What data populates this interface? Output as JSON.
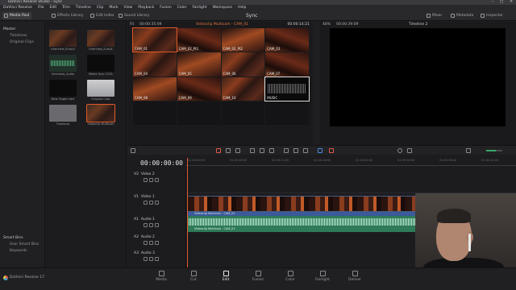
{
  "window": {
    "title": "DaVinci Resolve Studio - Sync"
  },
  "menubar": [
    "DaVinci Resolve",
    "File",
    "Edit",
    "Trim",
    "Timeline",
    "Clip",
    "Mark",
    "View",
    "Playback",
    "Fusion",
    "Color",
    "Fairlight",
    "Workspace",
    "Help"
  ],
  "toolbar": {
    "left": [
      "Media Pool",
      "Effects Library",
      "Edit Index",
      "Sound Library"
    ],
    "app_title": "Sync",
    "right": [
      "Mixer",
      "Metadata",
      "Inspector"
    ]
  },
  "sidebar": {
    "root": "Master",
    "items": [
      "Timelines",
      "Original Clips"
    ],
    "smart_bins_header": "Smart Bins",
    "smart_items": [
      "User Smart Bins",
      "Keywords"
    ]
  },
  "media_pool": {
    "clips": [
      {
        "name": "Interview_B.mp4",
        "kind": "concert"
      },
      {
        "name": "Interview_A.mp4",
        "kind": "concert"
      },
      {
        "name": "Interview_Audio",
        "kind": "audio"
      },
      {
        "name": "Media Sync 2021",
        "kind": "dark"
      },
      {
        "name": "New Single mp4",
        "kind": "dark"
      },
      {
        "name": "Original Clips",
        "kind": "folder"
      },
      {
        "name": "Timelines",
        "kind": "folder"
      },
      {
        "name": "Videoclip Multicam",
        "kind": "concert",
        "selected": true
      }
    ]
  },
  "source_viewer": {
    "zoom": "Fit",
    "left_tc": "00:00:35:09",
    "clip_name": "Videoclip Multicam - CAM_01",
    "right_tc": "00:00:14:21",
    "angles": [
      "CAM_01",
      "CAM_02_Pt1",
      "CAM_02_Pt2",
      "CAM_03",
      "CAM_04",
      "CAM_05",
      "CAM_06",
      "CAM_07",
      "CAM_08",
      "CAM_09",
      "CAM_10",
      "MUSIC"
    ],
    "active_angle": "CAM_01"
  },
  "timeline_viewer": {
    "zoom": "48%",
    "tc": "00:00:39:09",
    "timeline_name": "Timeline 2"
  },
  "timeline": {
    "timecode": "00:00:00:00",
    "ruler": [
      "01:00:00:00",
      "01:00:06:00",
      "01:00:12:00",
      "01:00:18:00",
      "01:00:24:00",
      "01:00:30:00",
      "01:00:36:00",
      "01:00:42:00"
    ],
    "tracks": [
      {
        "id": "V2",
        "name": "Video 2"
      },
      {
        "id": "V1",
        "name": "Video 1"
      },
      {
        "id": "A1",
        "name": "Audio 1"
      },
      {
        "id": "A2",
        "name": "Audio 2"
      },
      {
        "id": "A3",
        "name": "Audio 3"
      }
    ],
    "video_clip_label": "Videoclip Multicam - CAM_01",
    "audio_clip_label": "Videoclip Multicam - CAM_01"
  },
  "pages": [
    "Media",
    "Cut",
    "Edit",
    "Fusion",
    "Color",
    "Fairlight",
    "Deliver"
  ],
  "active_page": "Edit",
  "brand": "DaVinci Resolve 17"
}
